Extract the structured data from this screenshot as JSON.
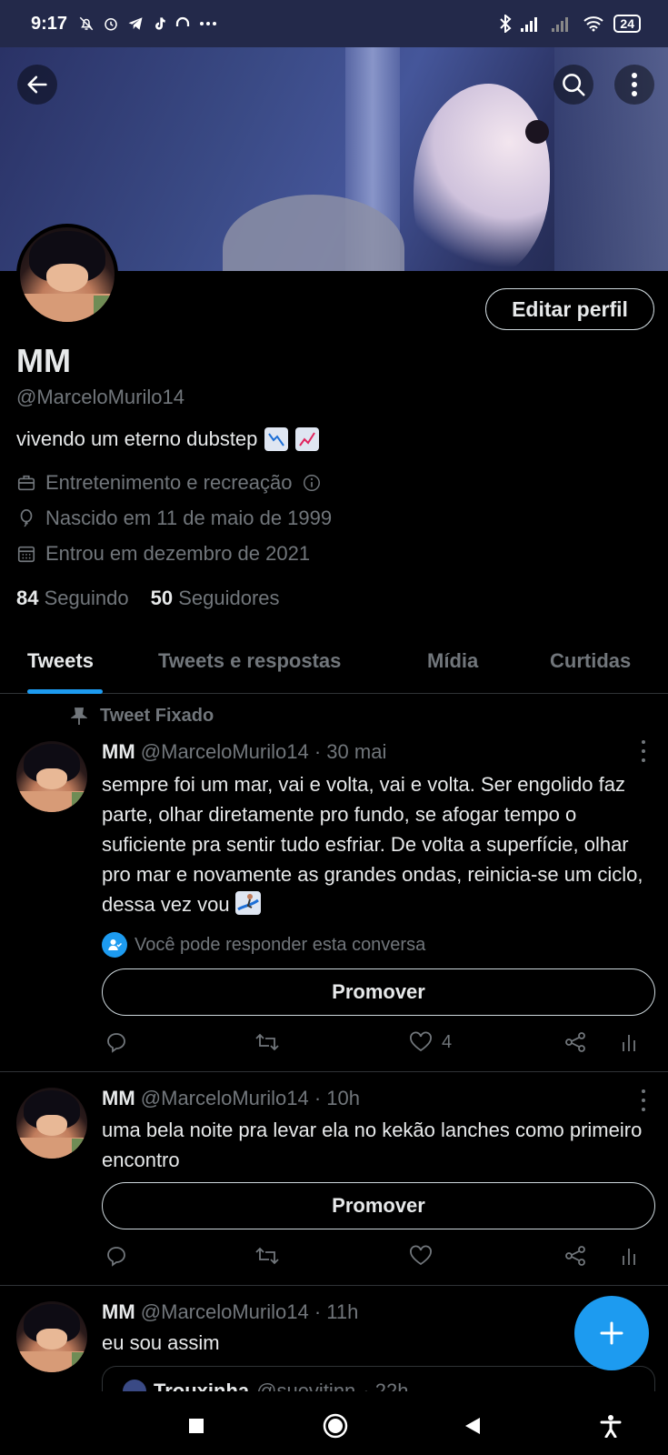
{
  "status_bar": {
    "time": "9:17",
    "battery": "24",
    "icons": [
      "bell-off-icon",
      "alarm-icon",
      "telegram-icon",
      "tiktok-icon",
      "headset-icon",
      "more-icon",
      "bluetooth-icon",
      "signal-icon",
      "signal-icon",
      "wifi-icon",
      "battery-icon"
    ]
  },
  "header": {
    "back_icon": "arrow-left-icon",
    "search_icon": "search-icon",
    "menu_icon": "more-vertical-icon"
  },
  "profile": {
    "edit_button": "Editar perfil",
    "name": "MM",
    "handle": "@MarceloMurilo14",
    "bio": "vivendo um eterno dubstep",
    "bio_emojis": [
      "chart-decreasing-emoji",
      "chart-increasing-emoji"
    ],
    "category": "Entretenimento e recreação",
    "birthday": "Nascido em 11 de maio de 1999",
    "joined": "Entrou em dezembro de 2021",
    "following_count": "84",
    "following_label": "Seguindo",
    "followers_count": "50",
    "followers_label": "Seguidores"
  },
  "tabs": [
    {
      "label": "Tweets",
      "active": true
    },
    {
      "label": "Tweets e respostas",
      "active": false
    },
    {
      "label": "Mídia",
      "active": false
    },
    {
      "label": "Curtidas",
      "active": false
    }
  ],
  "tweets": [
    {
      "pinned_label": "Tweet Fixado",
      "name": "MM",
      "handle": "@MarceloMurilo14",
      "time": "· 30 mai",
      "text": "sempre foi um mar, vai e volta, vai e volta. Ser engolido faz parte, olhar diretamente pro fundo, se afogar tempo o suficiente pra sentir tudo esfriar. De volta a superfície, olhar pro mar e novamente as grandes ondas, reinicia-se um ciclo, dessa vez vou",
      "reply_note": "Você pode responder esta conversa",
      "promote": "Promover",
      "likes": "4"
    },
    {
      "name": "MM",
      "handle": "@MarceloMurilo14",
      "time": "· 10h",
      "text": "uma bela noite pra levar ela no kekão lanches como primeiro encontro",
      "promote": "Promover",
      "likes": ""
    },
    {
      "name": "MM",
      "handle": "@MarceloMurilo14",
      "time": "· 11h",
      "text": "eu sou assim",
      "quote_name": "Trouxinha",
      "quote_handle": "@suevitinn",
      "quote_time": "· 22h"
    }
  ],
  "colors": {
    "accent": "#1d9bf0",
    "background": "#000000",
    "text": "#e7e9ea",
    "muted": "#71767b",
    "status_bar": "#23294a"
  }
}
